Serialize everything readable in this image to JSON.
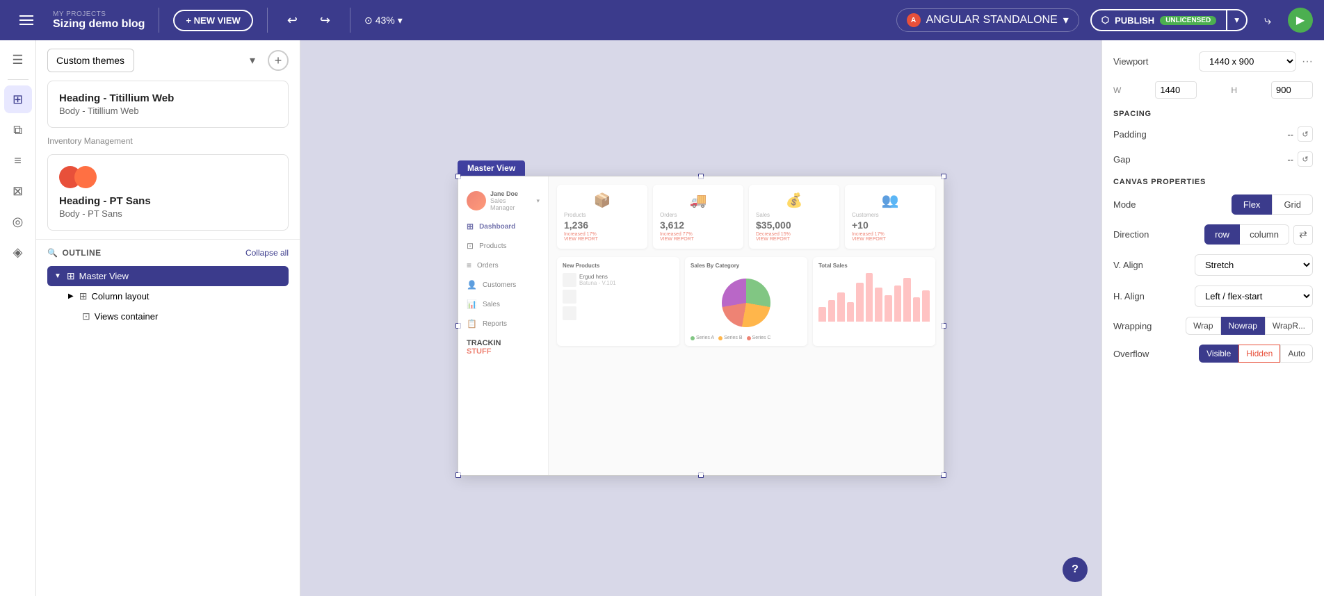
{
  "topbar": {
    "my_projects": "MY PROJECTS",
    "title": "Sizing demo blog",
    "new_view_label": "+ NEW VIEW",
    "zoom_label": "43%",
    "framework_label": "ANGULAR STANDALONE",
    "publish_label": "PUBLISH",
    "publish_badge": "UNLICENSED",
    "share_icon": "⤷",
    "play_icon": "▶"
  },
  "left_panel": {
    "themes_label": "Custom themes",
    "add_icon": "+",
    "theme1": {
      "heading": "Heading - Titillium Web",
      "body": "Body - Titillium Web"
    },
    "section_label": "Inventory Management",
    "theme2": {
      "heading": "Heading - PT Sans",
      "body": "Body - PT Sans"
    }
  },
  "outline": {
    "title": "OUTLINE",
    "collapse_label": "Collapse all",
    "items": [
      {
        "label": "Master View",
        "level": 0,
        "selected": true,
        "hasChevron": true
      },
      {
        "label": "Column layout",
        "level": 1,
        "selected": false,
        "hasChevron": true
      },
      {
        "label": "Views container",
        "level": 2,
        "selected": false,
        "hasChevron": false
      }
    ]
  },
  "canvas": {
    "master_view_label": "Master View",
    "preview": {
      "user_name": "Jane Doe",
      "user_role": "Sales Manager",
      "nav_items": [
        "Dashboard",
        "Products",
        "Orders",
        "Customers",
        "Sales",
        "Reports"
      ],
      "cards": [
        {
          "label": "Products",
          "value": "1,236",
          "change": "Increased 17%"
        },
        {
          "label": "Orders",
          "value": "3,612",
          "change": "Increased 77%"
        },
        {
          "label": "Sales",
          "value": "$35,000",
          "change": "Decreased 15%"
        },
        {
          "label": "Customers",
          "value": "+10",
          "change": "Increased 17%"
        }
      ],
      "logo_line1": "TRACKIN",
      "logo_line2": "STUFF"
    }
  },
  "right_panel": {
    "viewport_label": "Viewport",
    "viewport_value": "1440 x 900",
    "w_label": "W",
    "w_value": "1440",
    "h_label": "H",
    "h_value": "900",
    "spacing_label": "SPACING",
    "padding_label": "Padding",
    "padding_value": "--",
    "gap_label": "Gap",
    "gap_value": "--",
    "canvas_props_label": "CANVAS PROPERTIES",
    "mode_label": "Mode",
    "mode_flex": "Flex",
    "mode_grid": "Grid",
    "direction_label": "Direction",
    "dir_row": "row",
    "dir_column": "column",
    "valign_label": "V. Align",
    "valign_value": "Stretch",
    "halign_label": "H. Align",
    "halign_value": "Left / flex-start",
    "wrapping_label": "Wrapping",
    "wrap_label": "Wrap",
    "nowrap_label": "Nowrap",
    "wraprev_label": "WrapR...",
    "overflow_label": "Overflow",
    "visible_label": "Visible",
    "hidden_label": "Hidden",
    "auto_label": "Auto"
  },
  "icons": {
    "hamburger": "☰",
    "undo": "↩",
    "redo": "↪",
    "zoom_icon": "⊙",
    "chevron_down": "▾",
    "search": "🔍",
    "question": "?",
    "swap": "⇄"
  }
}
